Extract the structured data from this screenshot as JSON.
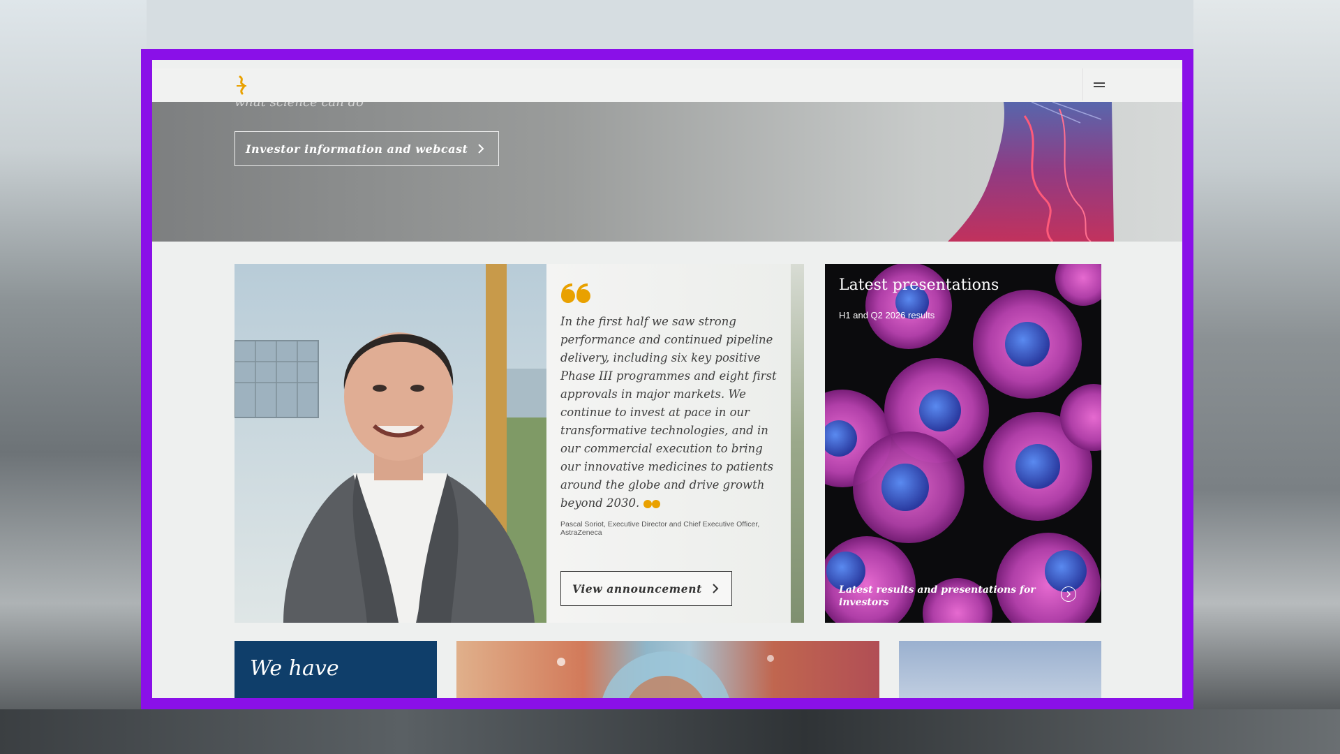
{
  "header": {
    "logo_icon": "astrazeneca-logo-icon",
    "menu_icon": "hamburger-menu-icon"
  },
  "hero": {
    "subtitle": "what science can do",
    "cta_label": "Investor information and webcast"
  },
  "quote_card": {
    "quote": "In the first half we saw strong performance and continued pipeline delivery, including six key positive Phase III programmes and eight first approvals in major markets. We continue to invest at pace in our transformative technologies, and in our commercial execution to bring our innovative medicines to patients around the globe and drive growth beyond 2030.",
    "author": "Pascal Soriot, Executive Director and Chief Executive Officer, AstraZeneca",
    "button_label": "View announcement",
    "accent_color": "#e9a100"
  },
  "presentations_card": {
    "title": "Latest presentations",
    "subtitle": "H1 and Q2 2026 results",
    "footer": "Latest results and presentations for investors"
  },
  "row2": {
    "blue_tile_text": "We have"
  },
  "colors": {
    "frame": "#8a10e8",
    "brand_gold": "#e9a100",
    "tile_blue": "#0f3e6a"
  }
}
